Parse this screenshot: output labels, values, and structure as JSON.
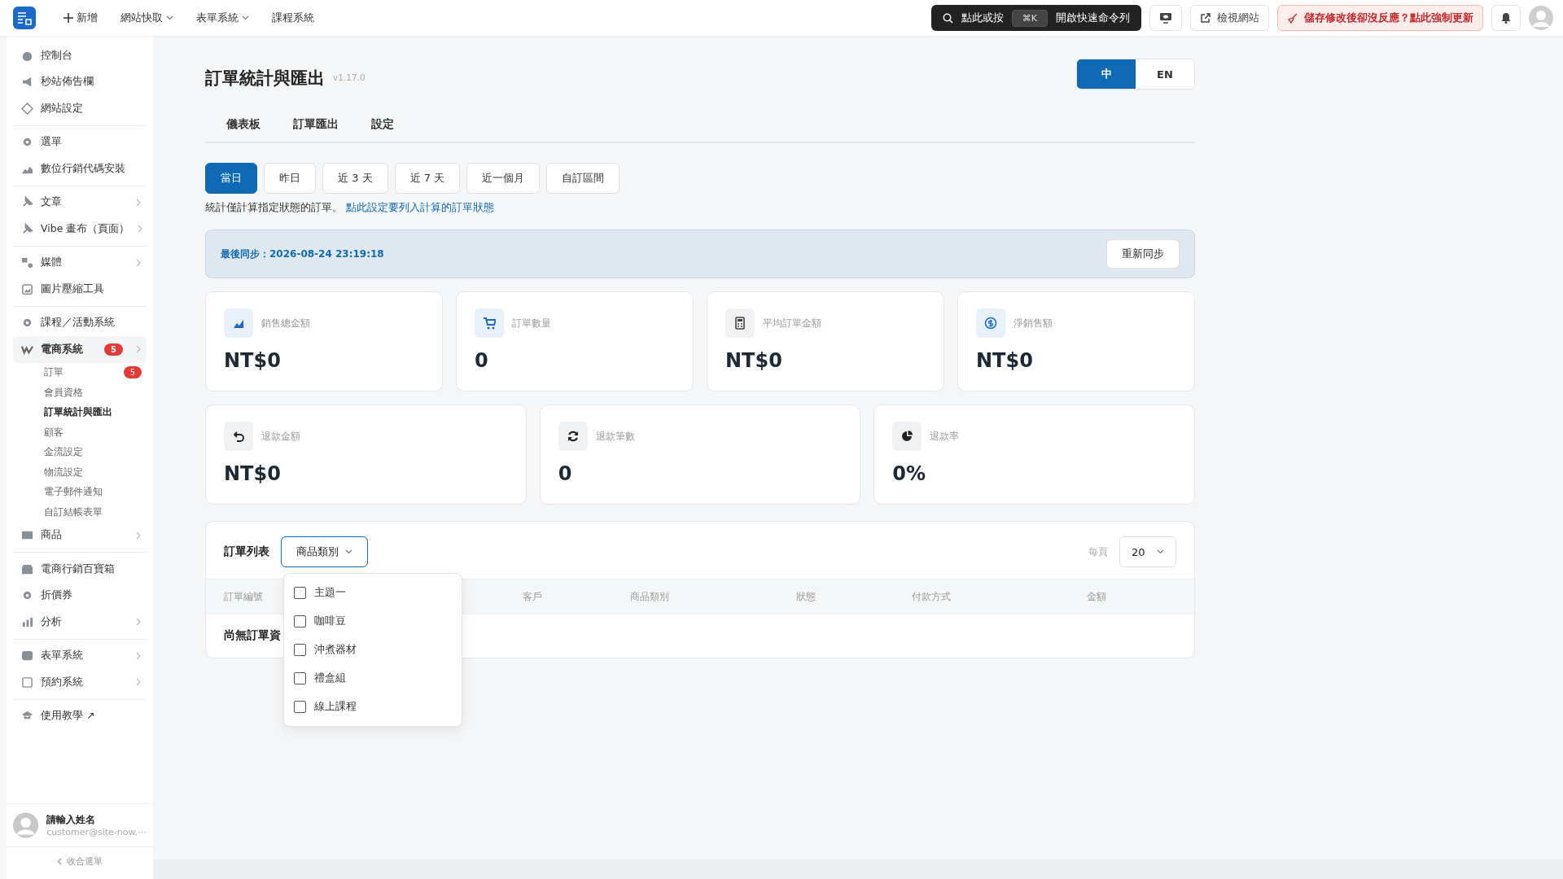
{
  "topbar": {
    "menu": [
      {
        "label": "新增",
        "kind": "add"
      },
      {
        "label": "網站快取",
        "kind": "dropdown"
      },
      {
        "label": "表單系統",
        "kind": "dropdown"
      },
      {
        "label": "課程系統",
        "kind": "plain"
      }
    ],
    "command": {
      "prefix": "點此或按",
      "shortcut": "⌘K",
      "suffix": "開啟快速命令列"
    },
    "view_site": "檢視網站",
    "force_update": "儲存修改後卻沒反應？點此強制更新"
  },
  "sidebar": {
    "groups": [
      [
        {
          "label": "控制台",
          "expandable": false,
          "selected": false
        },
        {
          "label": "秒站佈告欄",
          "expandable": false,
          "selected": false
        },
        {
          "label": "網站設定",
          "expandable": false,
          "selected": false
        }
      ],
      [
        {
          "label": "選單",
          "expandable": false,
          "selected": false
        },
        {
          "label": "數位行銷代碼安裝",
          "expandable": false,
          "selected": false
        }
      ],
      [
        {
          "label": "文章",
          "expandable": true,
          "selected": false
        },
        {
          "label": "Vibe 畫布（頁面）",
          "expandable": true,
          "selected": false
        }
      ],
      [
        {
          "label": "媒體",
          "expandable": true,
          "selected": false
        },
        {
          "label": "圖片壓縮工具",
          "expandable": false,
          "selected": false
        }
      ],
      [
        {
          "label": "課程／活動系統",
          "expandable": false,
          "selected": false
        },
        {
          "label": "電商系統",
          "expandable": true,
          "selected": true,
          "badge": "5",
          "children": [
            {
              "label": "訂單",
              "selected": false,
              "badge": "5"
            },
            {
              "label": "會員資格",
              "selected": false
            },
            {
              "label": "訂單統計與匯出",
              "selected": true
            },
            {
              "label": "顧客",
              "selected": false
            },
            {
              "label": "金流設定",
              "selected": false
            },
            {
              "label": "物流設定",
              "selected": false
            },
            {
              "label": "電子郵件通知",
              "selected": false
            },
            {
              "label": "自訂結帳表單",
              "selected": false
            }
          ]
        },
        {
          "label": "商品",
          "expandable": true,
          "selected": false
        }
      ],
      [
        {
          "label": "電商行銷百寶箱",
          "expandable": false,
          "selected": false
        },
        {
          "label": "折價券",
          "expandable": false,
          "selected": false
        },
        {
          "label": "分析",
          "expandable": true,
          "selected": false
        }
      ],
      [
        {
          "label": "表單系統",
          "expandable": true,
          "selected": false
        },
        {
          "label": "預約系統",
          "expandable": true,
          "selected": false
        }
      ],
      [
        {
          "label": "使用教學 ↗",
          "expandable": false,
          "selected": false
        }
      ]
    ],
    "user": {
      "name": "請輸入姓名",
      "email": "customer@site-now.⋯"
    },
    "collapse": "收合選單"
  },
  "page": {
    "title": "訂單統計與匯出",
    "version": "v1.17.0",
    "languages": [
      {
        "label": "中",
        "selected": true
      },
      {
        "label": "EN",
        "selected": false
      }
    ],
    "tabs": [
      "儀表板",
      "訂單匯出",
      "設定"
    ],
    "periods": [
      {
        "label": "當日",
        "selected": true
      },
      {
        "label": "昨日",
        "selected": false
      },
      {
        "label": "近 3 天",
        "selected": false
      },
      {
        "label": "近 7 天",
        "selected": false
      },
      {
        "label": "近一個月",
        "selected": false
      },
      {
        "label": "自訂區間",
        "selected": false
      }
    ],
    "note": {
      "text": "統計僅計算指定狀態的訂單。",
      "link": "點此設定要列入計算的訂單狀態"
    },
    "sync": {
      "text": "最後同步：2026-08-24 23:19:18",
      "button": "重新同步"
    },
    "stats": [
      [
        {
          "label": "銷售總金額",
          "value": "NT$0"
        },
        {
          "label": "訂單數量",
          "value": "0"
        },
        {
          "label": "平均訂單金額",
          "value": "NT$0"
        },
        {
          "label": "淨銷售額",
          "value": "NT$0"
        }
      ],
      [
        {
          "label": "退款金額",
          "value": "NT$0"
        },
        {
          "label": "退款筆數",
          "value": "0"
        },
        {
          "label": "退款率",
          "value": "0%"
        }
      ]
    ],
    "orders": {
      "title": "訂單列表",
      "filter": {
        "label": "商品類別",
        "expanded": true,
        "options": [
          {
            "label": "主題一",
            "checked": false
          },
          {
            "label": "咖啡豆",
            "checked": false
          },
          {
            "label": "沖煮器材",
            "checked": false
          },
          {
            "label": "禮盒組",
            "checked": false
          },
          {
            "label": "線上課程",
            "checked": false
          }
        ]
      },
      "per_page_label": "每頁",
      "per_page": "20",
      "columns": [
        "訂單編號",
        "客戶",
        "商品類別",
        "狀態",
        "付款方式",
        "金額"
      ],
      "empty": "尚無訂單資"
    }
  }
}
